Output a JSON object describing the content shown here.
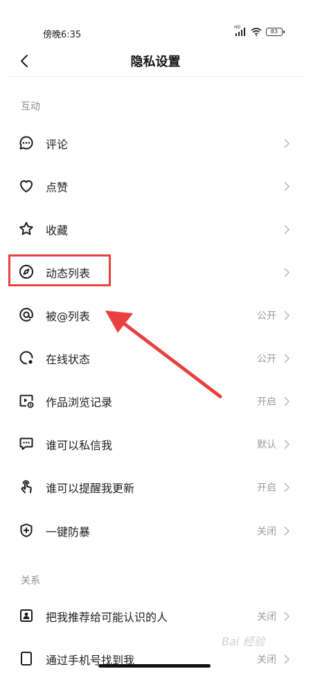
{
  "status_bar": {
    "time": "傍晚6:35",
    "network_label": "HD",
    "battery_level": "83"
  },
  "header": {
    "title": "隐私设置"
  },
  "sections": {
    "interaction_title": "互动",
    "relation_title": "关系"
  },
  "items": [
    {
      "label": "评论",
      "value": ""
    },
    {
      "label": "点赞",
      "value": ""
    },
    {
      "label": "收藏",
      "value": ""
    },
    {
      "label": "动态列表",
      "value": ""
    },
    {
      "label": "被@列表",
      "value": "公开"
    },
    {
      "label": "在线状态",
      "value": "公开"
    },
    {
      "label": "作品浏览记录",
      "value": "开启"
    },
    {
      "label": "谁可以私信我",
      "value": "默认"
    },
    {
      "label": "谁可以提醒我更新",
      "value": "开启"
    },
    {
      "label": "一键防暴",
      "value": "关闭"
    },
    {
      "label": "把我推荐给可能认识的人",
      "value": "关闭"
    },
    {
      "label": "通过手机号找到我",
      "value": "关闭"
    }
  ],
  "watermark": "Bai 经验",
  "colors": {
    "highlight": "#e8403f",
    "secondary_text": "#9b9b9b",
    "section_text": "#8a8a8a"
  }
}
